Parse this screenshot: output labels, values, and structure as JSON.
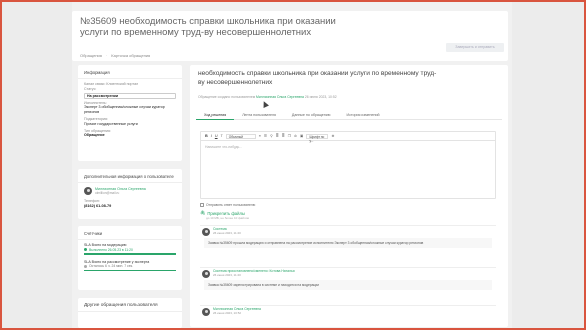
{
  "header": {
    "title": "№35609 необходимость справки школьника при оказании услуги по временному труд-ву несовершеннолетних",
    "breadcrumb": [
      "Обращения",
      "Карточка обращения"
    ],
    "send_button": "Завершить и отправить"
  },
  "info": {
    "section_title": "Информация",
    "fields": [
      {
        "key": "Канал связи: Клиентский портал",
        "value": ""
      },
      {
        "key": "Статус:",
        "value": "На рассмотрении"
      },
      {
        "key": "Исполнитель:",
        "value": "Эксперт 3 обобщенная/сложные случаи куратор регионов"
      },
      {
        "key": "Подкатегория:",
        "value": "Прочие государственные услуги"
      },
      {
        "key": "Тип обращения:",
        "value": "Обращение"
      }
    ]
  },
  "contact": {
    "section_title": "Дополнительная информация о пользователе",
    "name": "Миллионная Ольга Сергеевна",
    "email": "olmillion@mail.ru",
    "phone_label": "Телефон:",
    "phone": "(8162) 61-08-79"
  },
  "sla": {
    "section_title": "Счётчики",
    "items": [
      {
        "label": "SLA Взято на модерацию",
        "value": "Выполнено 26.05.23 в 11:20",
        "status": "done"
      },
      {
        "label": "SLA Взято на рассмотрение у эксперта",
        "value": "Осталось 6 ч. 24 мин. 7 сек.",
        "status": "pending"
      }
    ]
  },
  "other": {
    "section_title": "Другие обращения пользователя"
  },
  "main": {
    "heading": "необходимость справки школьника при оказании услуги по временному труд-ву несовершеннолетних",
    "meta_prefix": "Обращение создано пользователем",
    "meta_author": "Миллионная Ольга Сергеевна",
    "meta_date": "26 июня 2023, 10:52",
    "tabs": [
      "Ход решения",
      "Лента пользователя",
      "Данные по обращению",
      "История изменений"
    ],
    "editor": {
      "format_select": "Обычный",
      "size_select": "Шрифт по у...",
      "placeholder": "Напишите что-нибудь..."
    },
    "send_to_user_label": "Отправить ответ пользователю",
    "attach_label": "Прикрепить файлы",
    "attach_hint": "до 10 МБ, не более 10 файлов",
    "entries": [
      {
        "who": "Система",
        "when": "26 июня 2023, 11:20",
        "text": "Заявка №35609 прошла модерацию и отправлена на рассмотрение исполнителю Эксперт 3 обобщенная/сложные случаи куратор регионов"
      },
      {
        "who": "Система приостановлено/сменено: Котова Наталья",
        "when": "26 июня 2023, 11:20",
        "text": "Заявка №35609 зарегистрирована в системе и находится на модерации"
      },
      {
        "who": "Миллионная Ольга Сергеевна",
        "when": "26 июня 2023, 10:52",
        "text": ""
      }
    ]
  }
}
